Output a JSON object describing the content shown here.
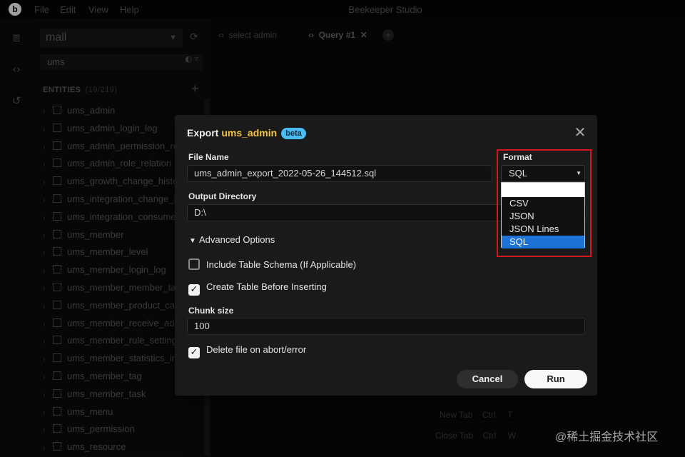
{
  "app": {
    "title": "Beekeeper Studio",
    "menu": [
      "File",
      "Edit",
      "View",
      "Help"
    ]
  },
  "sidebar": {
    "connection": "mall",
    "filter": "ums",
    "entities_label": "ENTITIES",
    "entities_count": "(19/219)",
    "tables": [
      "ums_admin",
      "ums_admin_login_log",
      "ums_admin_permission_relation",
      "ums_admin_role_relation",
      "ums_growth_change_history",
      "ums_integration_change_history",
      "ums_integration_consume_setting",
      "ums_member",
      "ums_member_level",
      "ums_member_login_log",
      "ums_member_member_tag_relation",
      "ums_member_product_category_relation",
      "ums_member_receive_address",
      "ums_member_rule_setting",
      "ums_member_statistics_info",
      "ums_member_tag",
      "ums_member_task",
      "ums_menu",
      "ums_permission",
      "ums_resource"
    ]
  },
  "tabs": [
    {
      "label": "select admin"
    },
    {
      "label": "Query #1"
    }
  ],
  "shortcuts": [
    {
      "label": "New Tab",
      "keys": [
        "Ctrl",
        "T"
      ]
    },
    {
      "label": "Close Tab",
      "keys": [
        "Ctrl",
        "W"
      ]
    }
  ],
  "dialog": {
    "title_prefix": "Export",
    "table_name": "ums_admin",
    "badge": "beta",
    "file_name_label": "File Name",
    "file_name_value": "ums_admin_export_2022-05-26_144512.sql",
    "output_dir_label": "Output Directory",
    "output_dir_value": "D:\\",
    "format_label": "Format",
    "format_value": "SQL",
    "format_options": [
      "CSV",
      "JSON",
      "JSON Lines",
      "SQL"
    ],
    "advanced_label": "Advanced Options",
    "include_schema_label": "Include Table Schema (If Applicable)",
    "include_schema_checked": false,
    "create_table_label": "Create Table Before Inserting",
    "create_table_checked": true,
    "chunk_size_label": "Chunk size",
    "chunk_size_value": "100",
    "delete_on_abort_label": "Delete file on abort/error",
    "delete_on_abort_checked": true,
    "cancel_label": "Cancel",
    "run_label": "Run"
  },
  "watermark": "@稀土掘金技术社区",
  "colors": {
    "accent_table_name": "#f5c542",
    "beta_badge": "#4cbcf0",
    "highlight_box": "#d0181e",
    "selected_option": "#1d72d6"
  }
}
